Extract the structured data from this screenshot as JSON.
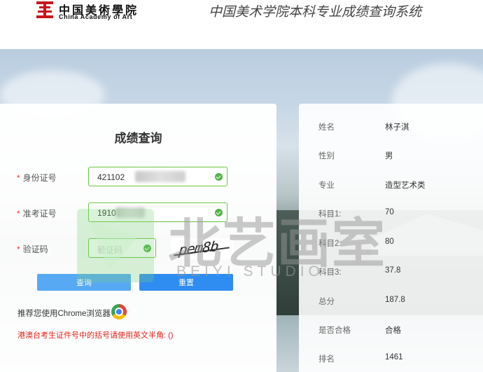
{
  "header": {
    "logo_cn": "中国美術學院",
    "logo_en": "China Academy of Art",
    "system_title": "中国美术学院本科专业成绩查询系统"
  },
  "form": {
    "title": "成绩查询",
    "id_label": "身份证号",
    "id_value": "421102",
    "exam_label": "准考证号",
    "exam_value": "1910",
    "captcha_label": "验证码",
    "captcha_placeholder": "验证码",
    "captcha_image_text": "pem8b",
    "query_label": "查询",
    "reset_label": "重置",
    "browser_tip": "推荐您使用Chrome浏览器",
    "warning": "港澳台考生证件号中的括号请使用英文半角: ()"
  },
  "results": [
    {
      "label": "姓名",
      "value": "林子淇"
    },
    {
      "label": "性别",
      "value": "男"
    },
    {
      "label": "专业",
      "value": "造型艺术类"
    },
    {
      "label": "科目1:",
      "value": "70"
    },
    {
      "label": "科目2:",
      "value": "80"
    },
    {
      "label": "科目3:",
      "value": "37.8"
    },
    {
      "label": "总分",
      "value": "187.8"
    },
    {
      "label": "是否合格",
      "value": "合格"
    },
    {
      "label": "排名",
      "value": "1461"
    }
  ],
  "watermark": {
    "text": "北艺画室",
    "sub": "BEIYI STUDIO"
  },
  "colors": {
    "accent": "#2f8df2",
    "valid": "#6cc644",
    "warning": "#e2231a",
    "logo_red": "#c8161d"
  }
}
